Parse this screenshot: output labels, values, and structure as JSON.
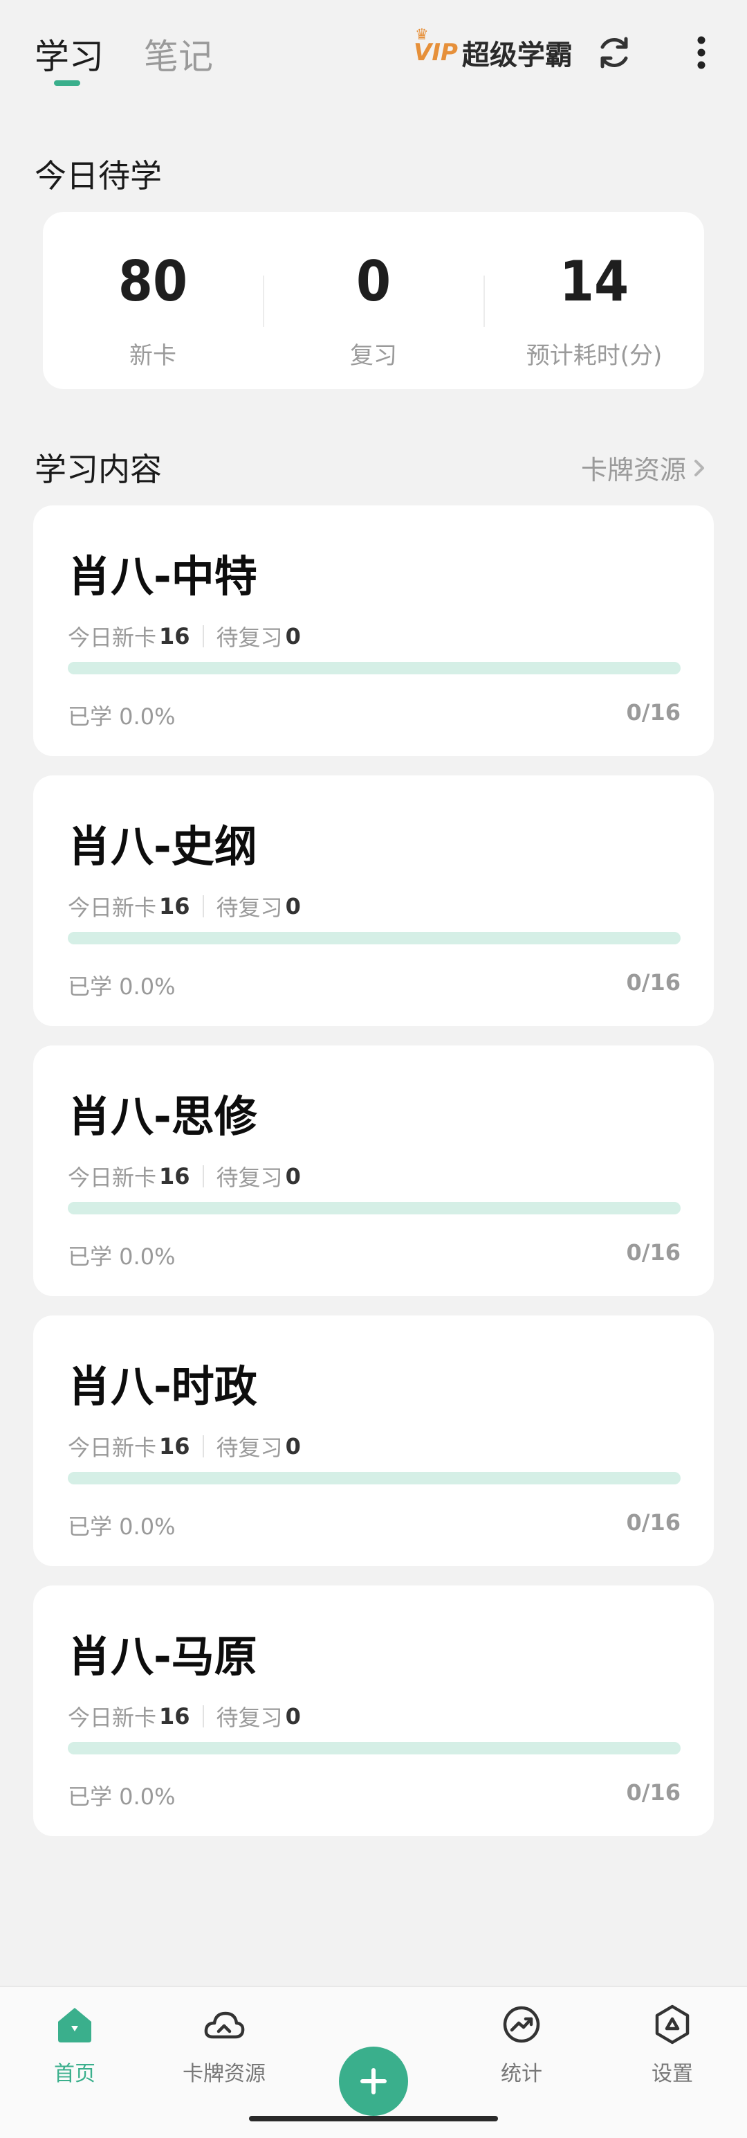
{
  "header": {
    "tabs": [
      {
        "label": "学习",
        "active": true
      },
      {
        "label": "笔记",
        "active": false
      }
    ],
    "vip_badge": "VIP",
    "vip_label": "超级学霸",
    "icons": [
      "refresh-icon",
      "more-vertical-icon"
    ]
  },
  "today": {
    "title": "今日待学",
    "stats": [
      {
        "value": "80",
        "label": "新卡"
      },
      {
        "value": "0",
        "label": "复习"
      },
      {
        "value": "14",
        "label": "预计耗时(分)"
      }
    ]
  },
  "content": {
    "title": "学习内容",
    "link_label": "卡牌资源",
    "decks": [
      {
        "title": "肖八-中特",
        "new_label": "今日新卡",
        "new_count": "16",
        "review_label": "待复习",
        "review_count": "0",
        "progress": 0.0,
        "learned_label": "已学 0.0%",
        "count_label": "0/16"
      },
      {
        "title": "肖八-史纲",
        "new_label": "今日新卡",
        "new_count": "16",
        "review_label": "待复习",
        "review_count": "0",
        "progress": 0.0,
        "learned_label": "已学 0.0%",
        "count_label": "0/16"
      },
      {
        "title": "肖八-思修",
        "new_label": "今日新卡",
        "new_count": "16",
        "review_label": "待复习",
        "review_count": "0",
        "progress": 0.0,
        "learned_label": "已学 0.0%",
        "count_label": "0/16"
      },
      {
        "title": "肖八-时政",
        "new_label": "今日新卡",
        "new_count": "16",
        "review_label": "待复习",
        "review_count": "0",
        "progress": 0.0,
        "learned_label": "已学 0.0%",
        "count_label": "0/16"
      },
      {
        "title": "肖八-马原",
        "new_label": "今日新卡",
        "new_count": "16",
        "review_label": "待复习",
        "review_count": "0",
        "progress": 0.0,
        "learned_label": "已学 0.0%",
        "count_label": "0/16"
      }
    ]
  },
  "nav": {
    "items": [
      {
        "label": "首页",
        "icon": "home-icon",
        "active": true
      },
      {
        "label": "卡牌资源",
        "icon": "cloud-icon",
        "active": false
      },
      {
        "label": "",
        "icon": "add-icon",
        "active": false
      },
      {
        "label": "统计",
        "icon": "trend-icon",
        "active": false
      },
      {
        "label": "设置",
        "icon": "settings-icon",
        "active": false
      }
    ]
  },
  "colors": {
    "accent": "#3aaf8c",
    "track": "#d5efe6",
    "background": "#f2f2f2",
    "vip": "#e6903a"
  }
}
